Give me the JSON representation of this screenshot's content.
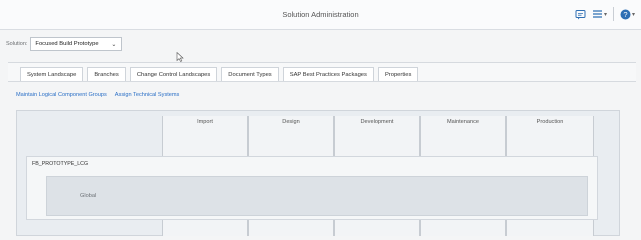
{
  "header": {
    "title": "Solution Administration",
    "icons": [
      "feedback-icon",
      "list-menu-icon",
      "help-icon"
    ]
  },
  "solution": {
    "label": "Solution:",
    "selected": "Focused Build Prototype"
  },
  "tabs": [
    {
      "label": "System Landscape"
    },
    {
      "label": "Branches"
    },
    {
      "label": "Change Control Landscapes"
    },
    {
      "label": "Document Types"
    },
    {
      "label": "SAP Best Practices Packages"
    },
    {
      "label": "Properties"
    }
  ],
  "links": {
    "maintain": "Maintain Logical Component Groups",
    "assign": "Assign Technical Systems"
  },
  "phases": [
    "Import",
    "Design",
    "Development",
    "Maintenance",
    "Production"
  ],
  "landscape": {
    "lcg_name": "FB_PROTOTYPE_LCG",
    "system_label": "Global"
  }
}
